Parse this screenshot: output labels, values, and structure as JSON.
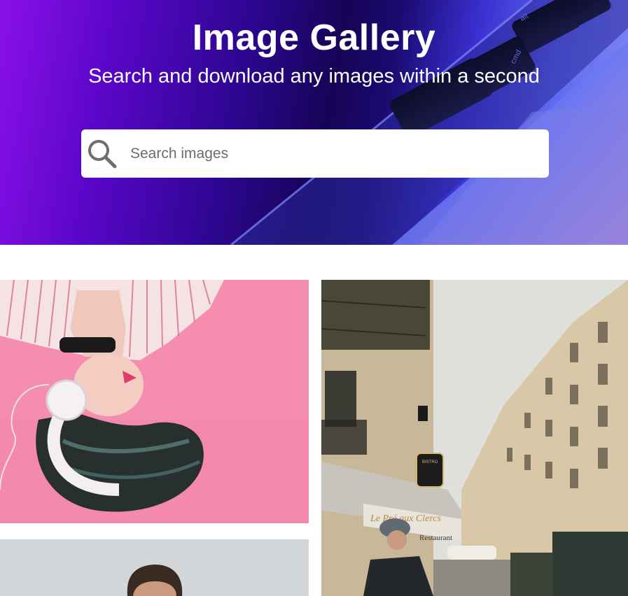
{
  "hero": {
    "title": "Image Gallery",
    "subtitle": "Search and download any images within a second",
    "search": {
      "placeholder": "Search images",
      "value": ""
    }
  },
  "gallery": {
    "images": [
      {
        "alt": "woman-with-headphones-on-pink-background"
      },
      {
        "alt": "paris-street-with-restaurant-le-pre-aux-clercs",
        "signs": [
          "Le Pré aux Clercs",
          "Restaurant",
          "BISTRO",
          "Le Pré aux Clercs"
        ]
      },
      {
        "alt": "portrait-of-man"
      }
    ]
  },
  "colors": {
    "hero_gradient_start": "#8a10e8",
    "hero_gradient_mid": "#160456",
    "hero_gradient_end": "#8a8cf4",
    "search_bg": "#ffffff",
    "title_text": "#ffffff"
  },
  "icons": {
    "search": "search-icon"
  }
}
